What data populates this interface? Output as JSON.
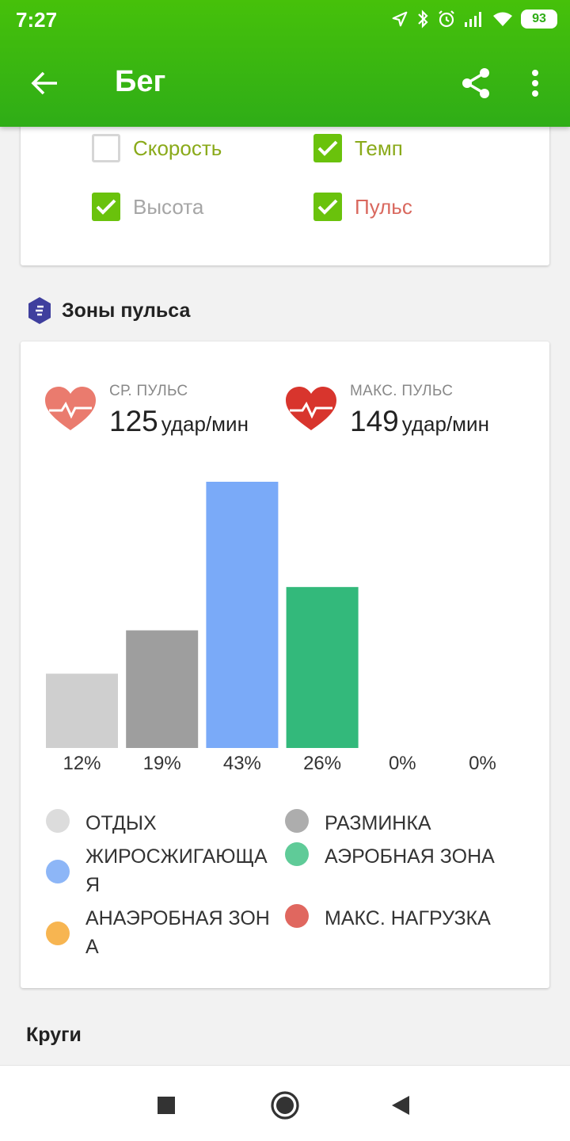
{
  "status": {
    "time": "7:27",
    "battery": "93"
  },
  "header": {
    "title": "Бег",
    "back_icon": "arrow-left-icon",
    "share_icon": "share-icon",
    "more_icon": "more-vert-icon"
  },
  "metrics": {
    "items": [
      {
        "label": "Скорость",
        "checked": false,
        "color": "#8aaa1a"
      },
      {
        "label": "Темп",
        "checked": true,
        "color": "#8aaa1a"
      },
      {
        "label": "Высота",
        "checked": true,
        "color": "#a6a6a6"
      },
      {
        "label": "Пульс",
        "checked": true,
        "color": "#d9685e"
      }
    ]
  },
  "zones_section": {
    "title": "Зоны пульса"
  },
  "stats": {
    "avg": {
      "label": "СР. ПУЛЬС",
      "value": "125",
      "unit": "удар/мин",
      "icon": "heart-rate-icon"
    },
    "max": {
      "label": "МАКС. ПУЛЬС",
      "value": "149",
      "unit": "удар/мин",
      "icon": "heart-rate-icon"
    }
  },
  "chart_data": {
    "type": "bar",
    "categories": [
      "ОТДЫХ",
      "РАЗМИНКА",
      "ЖИРОСЖИГАЮЩАЯ",
      "АЭРОБНАЯ ЗОНА",
      "АНАЭРОБНАЯ ЗОНА",
      "МАКС. НАГРУЗКА"
    ],
    "values": [
      12,
      19,
      43,
      26,
      0,
      0
    ],
    "value_labels": [
      "12%",
      "19%",
      "43%",
      "26%",
      "0%",
      "0%"
    ],
    "colors": [
      "#cfcfcf",
      "#9e9e9e",
      "#7aaaf8",
      "#33b97b",
      "#f7b551",
      "#e0675f"
    ],
    "legend": {
      "left": [
        "ОТДЫХ",
        "ЖИРОСЖИГАЮЩАЯ",
        "АНАЭРОБНАЯ ЗОНА"
      ],
      "right": [
        "РАЗМИНКА",
        "АЭРОБНАЯ ЗОНА",
        "МАКС. НАГРУЗКА"
      ],
      "left_colors": [
        "#dcdcdc",
        "#8db6f7",
        "#f7b551"
      ],
      "right_colors": [
        "#adadad",
        "#5fcb98",
        "#e0675f"
      ]
    }
  },
  "laps": {
    "title": "Круги"
  },
  "navbar": {
    "icons": [
      "recents-icon",
      "home-icon",
      "back-icon"
    ]
  }
}
